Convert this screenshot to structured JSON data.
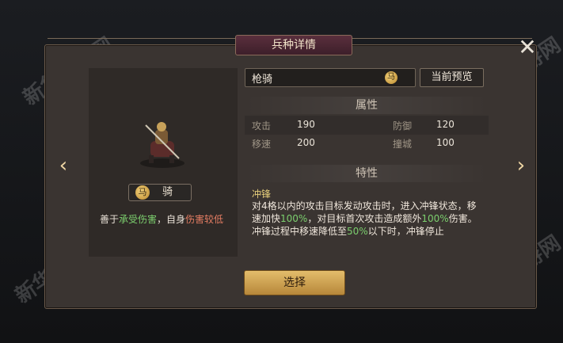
{
  "title": "兵种详情",
  "close_icon": "close-icon",
  "unit": {
    "name_box": "枪骑",
    "type_label": "骑",
    "badge_glyph": "马",
    "desc_prefix": "善于",
    "desc_good": "承受伤害",
    "desc_mid": "，自身",
    "desc_bad": "伤害较低"
  },
  "buttons": {
    "preview": "当前预览",
    "select": "选择"
  },
  "sections": {
    "attributes": "属性",
    "traits": "特性"
  },
  "attributes": [
    {
      "label": "攻击",
      "value": "190"
    },
    {
      "label": "防御",
      "value": "120"
    },
    {
      "label": "移速",
      "value": "200"
    },
    {
      "label": "撞城",
      "value": "100"
    }
  ],
  "trait": {
    "name": "冲锋",
    "text_1": "对4格以内的攻击目标发动攻击时，进入冲锋状态，移速加快",
    "value_1": "100%",
    "text_2": "，对目标首次攻击造成额外",
    "value_2": "100%",
    "text_3": "伤害。冲锋过程中移速降低至",
    "value_3": "50%",
    "text_4": "以下时，冲锋停止"
  },
  "watermark": "新华手游网",
  "colors": {
    "accent_gold": "#e3bd6b",
    "green": "#7ccf6e",
    "red": "#e57d63",
    "title_bg": "#5a2f3d"
  }
}
